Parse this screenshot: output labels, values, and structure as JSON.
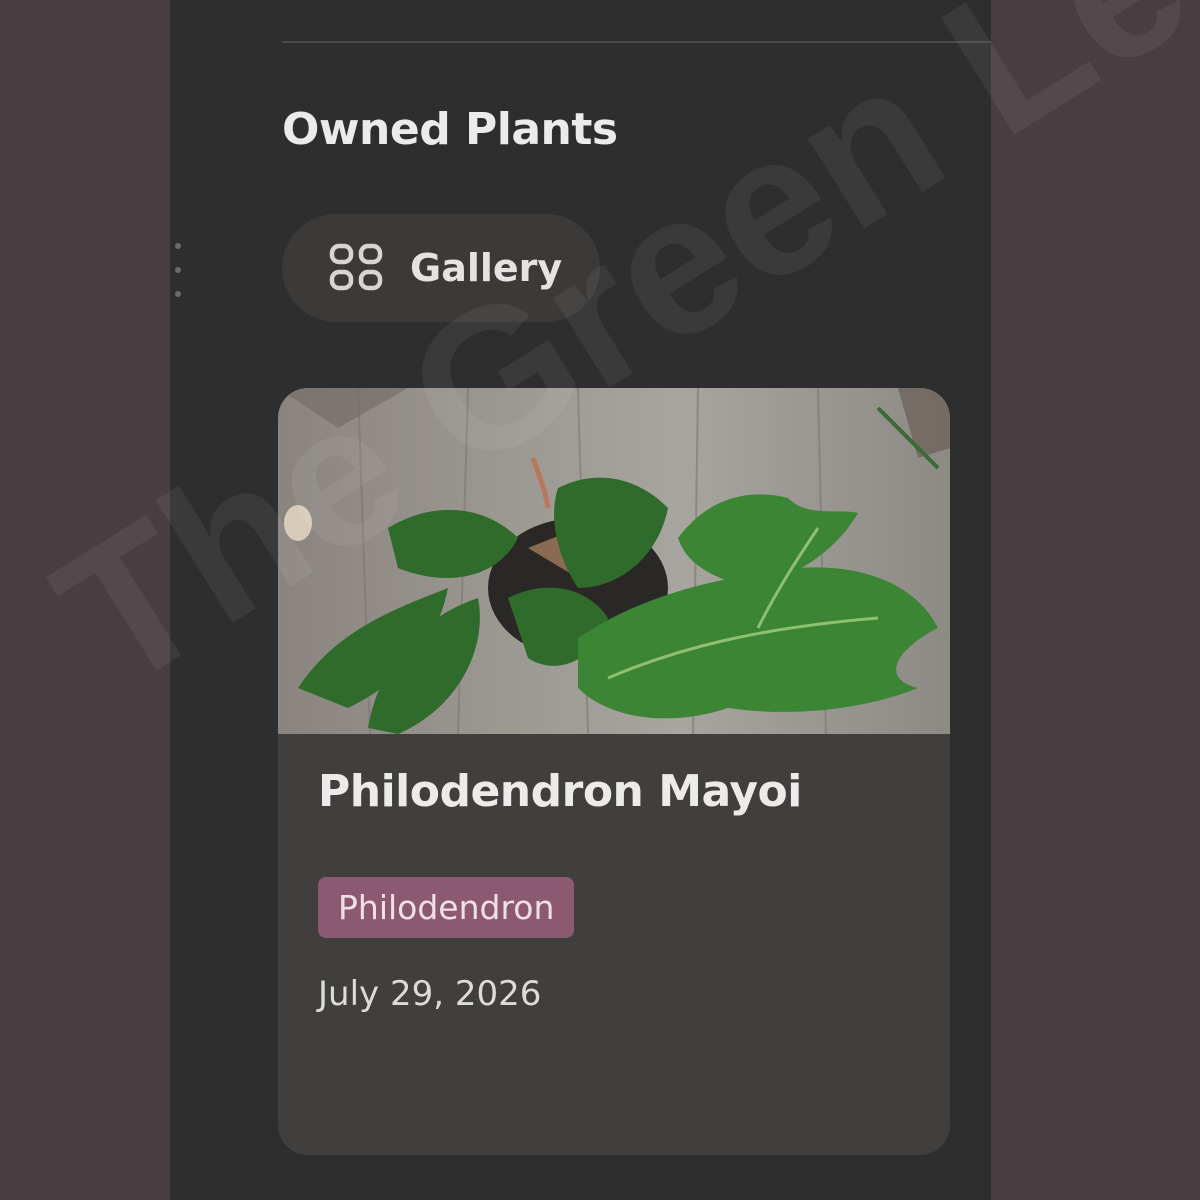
{
  "section": {
    "title": "Owned Plants"
  },
  "view_tab": {
    "label": "Gallery",
    "icon": "gallery-grid-icon"
  },
  "card": {
    "title": "Philodendron Mayoi",
    "tag": "Philodendron",
    "date": "July 29, 2026",
    "tag_color": "#8c5a70"
  },
  "watermark": {
    "text": "The Green Leaf"
  }
}
